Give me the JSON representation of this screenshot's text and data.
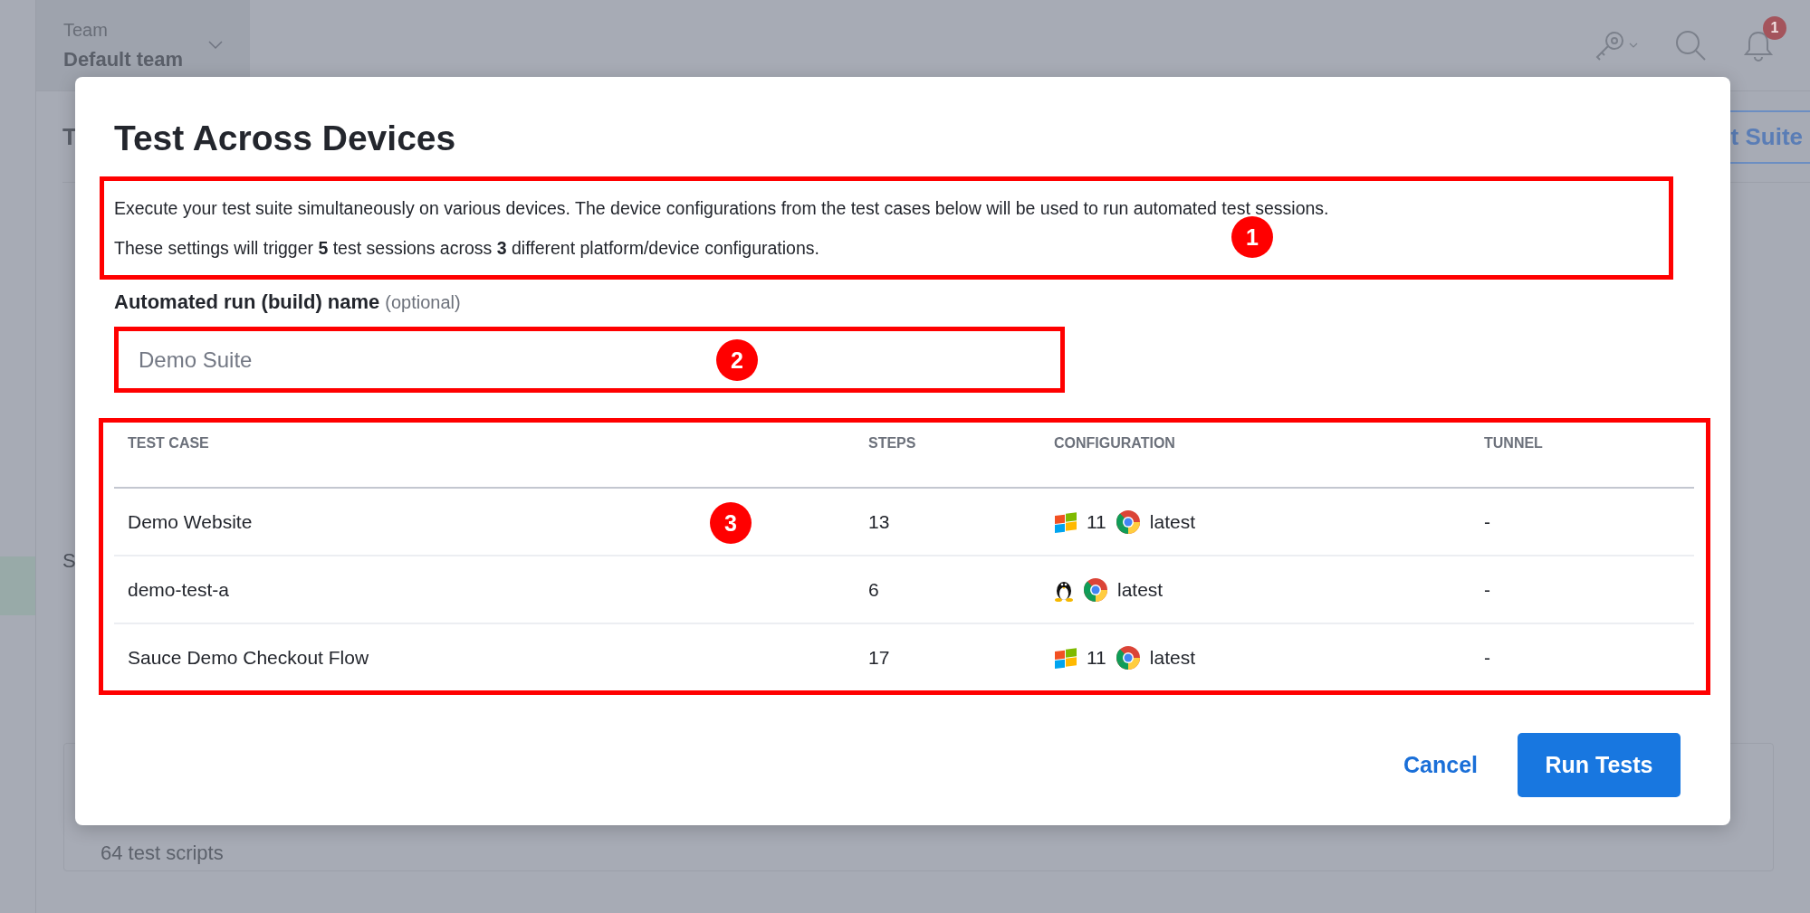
{
  "background": {
    "team_label": "Team",
    "team_name": "Default team",
    "notification_count": "1",
    "page_title_fragment": "T",
    "header_button_fragment": "t Suite",
    "section_fragment": "S",
    "card_text": "64 test scripts"
  },
  "dialog": {
    "title": "Test Across Devices",
    "description": {
      "annotation": "1",
      "lines": [
        "Execute your test suite simultaneously on various devices. The device configurations from the test cases below will be used to run automated test sessions.",
        "These settings will trigger **5** test sessions across **3** different platform/device configurations."
      ]
    },
    "build_name": {
      "label": "Automated run (build) name",
      "hint": "(optional)",
      "placeholder": "Demo Suite",
      "annotation": "2"
    },
    "table": {
      "annotation": "3",
      "columns": [
        "TEST CASE",
        "STEPS",
        "CONFIGURATION",
        "TUNNEL"
      ],
      "rows": [
        {
          "kind": "windows",
          "test_case": "Demo Website",
          "steps": "13",
          "os_version": "11",
          "browser_version": "latest",
          "tunnel": "-"
        },
        {
          "kind": "linux",
          "test_case": "demo-test-a",
          "steps": "6",
          "browser_version": "latest",
          "tunnel": "-"
        },
        {
          "kind": "windows",
          "test_case": "Sauce Demo Checkout Flow",
          "steps": "17",
          "os_version": "11",
          "browser_version": "latest",
          "tunnel": "-"
        }
      ]
    },
    "buttons": {
      "cancel": "Cancel",
      "run": "Run Tests"
    }
  }
}
